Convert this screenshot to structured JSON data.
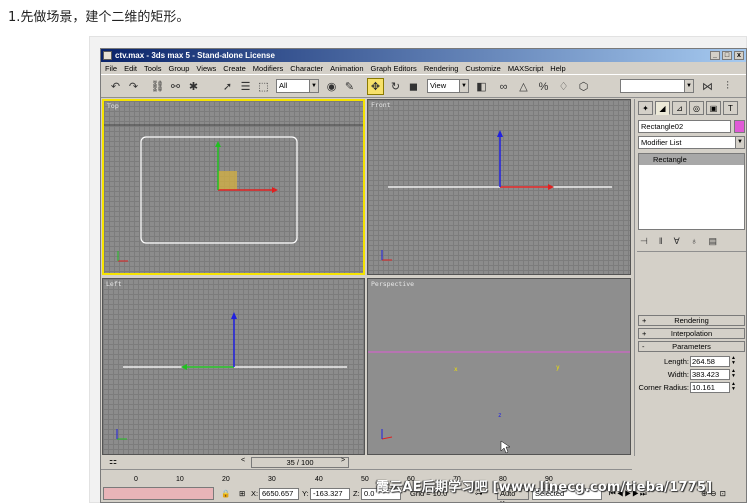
{
  "caption": "1.先做场景，建个二维的矩形。",
  "window": {
    "title": "ctv.max - 3ds max 5 - Stand-alone License",
    "buttons": [
      "_",
      "□",
      "x"
    ]
  },
  "menu": [
    "File",
    "Edit",
    "Tools",
    "Group",
    "Views",
    "Create",
    "Modifiers",
    "Character",
    "Animation",
    "Graph Editors",
    "Rendering",
    "Customize",
    "MAXScript",
    "Help"
  ],
  "toolbar": {
    "selection_filter": "All",
    "ref_coord": "View"
  },
  "viewports": {
    "top": "Top",
    "front": "Front",
    "left": "Left",
    "perspective": "Perspective",
    "axis_labels": {
      "x": "x",
      "y": "y",
      "z": "z"
    }
  },
  "command_panel": {
    "object_name": "Rectangle02",
    "object_color": "#e05ad6",
    "modifier_list": "Modifier List",
    "stack_item": "Rectangle",
    "rollouts": [
      "Rendering",
      "Interpolation",
      "Parameters"
    ],
    "rollout_signs": [
      "+",
      "+",
      "-"
    ],
    "params": [
      {
        "label": "Length:",
        "value": "264.58"
      },
      {
        "label": "Width:",
        "value": "383.423"
      },
      {
        "label": "Corner Radius:",
        "value": "10.161"
      }
    ]
  },
  "time_slider": {
    "frame": "35 / 100"
  },
  "trackbar_ticks": [
    "0",
    "10",
    "20",
    "30",
    "40",
    "50",
    "60",
    "70",
    "80",
    "90"
  ],
  "status": {
    "x_label": "X:",
    "x_value": "6650.657",
    "y_label": "Y:",
    "y_value": "-163.327",
    "z_label": "Z:",
    "z_value": "0.0",
    "grid": "Grid = 10.0",
    "auto_key": "Auto Key",
    "selected": "Selected"
  },
  "watermark": "霞云AE后期学习吧 [www.linecg.com/tieba/1775]",
  "colors": {
    "active_viewport": "#f5e300",
    "titlebar": "#0a246a",
    "x_axis": "#e02020",
    "y_axis": "#20c020",
    "z_axis": "#2020e0"
  }
}
